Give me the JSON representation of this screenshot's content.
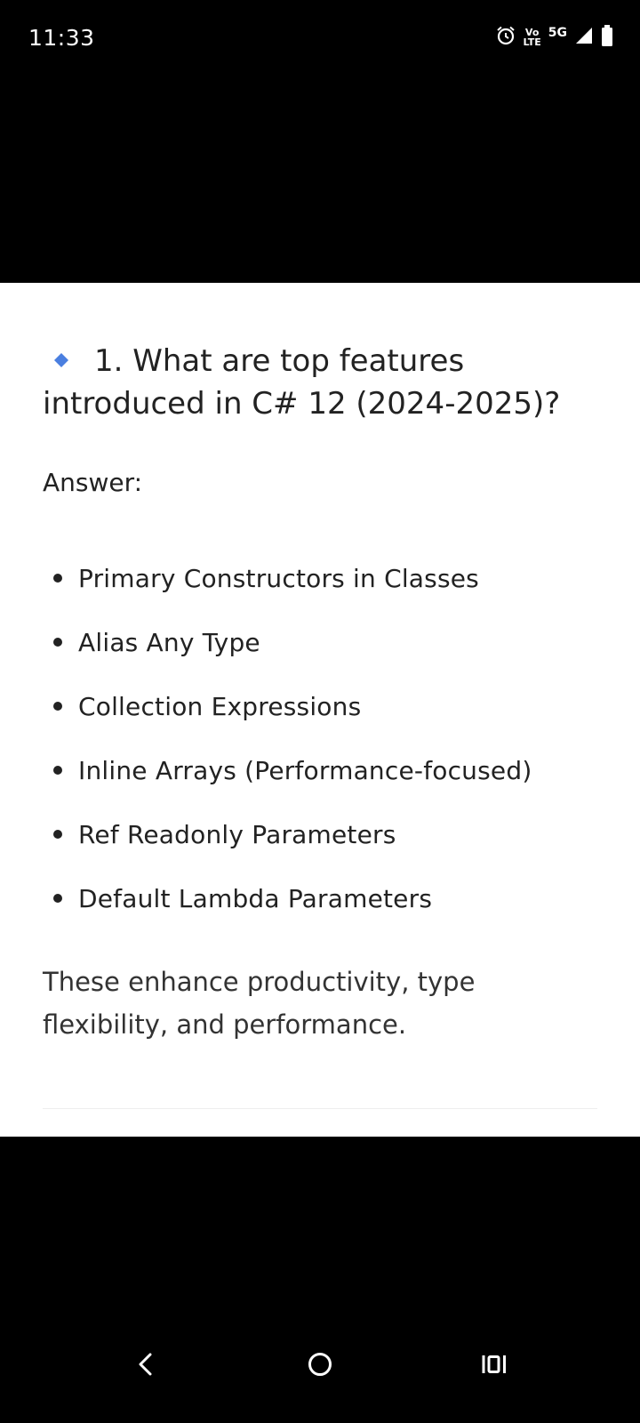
{
  "status_bar": {
    "time": "11:33",
    "volte_top": "Vo",
    "volte_bottom": "LTE",
    "network": "5G",
    "icons": [
      "alarm-icon",
      "volte-icon",
      "signal-icon",
      "battery-icon"
    ]
  },
  "content": {
    "question": "1. What are top features introduced in C# 12 (2024-2025)?",
    "diamond_color": "#4a7fe0",
    "answer_label": "Answer:",
    "features": [
      "Primary Constructors in Classes",
      "Alias Any Type",
      "Collection Expressions",
      "Inline Arrays (Performance-focused)",
      "Ref Readonly Parameters",
      "Default Lambda Parameters"
    ],
    "summary": "These enhance productivity, type flexibility, and performance."
  },
  "nav_bar": {
    "icons": [
      "back-icon",
      "home-icon",
      "recents-icon"
    ]
  }
}
